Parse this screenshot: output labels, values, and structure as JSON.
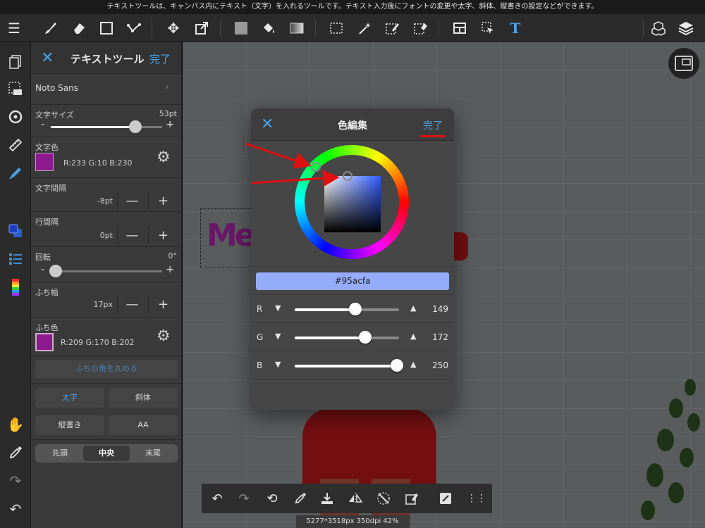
{
  "banner": "テキストツールは、キャンバス内にテキスト（文字）を入れるツールです。テキスト入力後にフォントの変更や太字、斜体、縦書きの設定などができます。",
  "panel": {
    "title": "テキストツール",
    "done": "完了",
    "font": "Noto Sans",
    "font_size_label": "文字サイズ",
    "font_size_value": "53pt",
    "font_size_level": 0.76,
    "text_color_label": "文字色",
    "text_color_rgb": "R:233 G:10 B:230",
    "text_color_hex": "#8e1a90",
    "letter_spacing_label": "文字間隔",
    "letter_spacing_value": "-8pt",
    "line_spacing_label": "行間隔",
    "line_spacing_value": "0pt",
    "rotation_label": "回転",
    "rotation_value": "0°",
    "rotation_level": 0.0,
    "border_width_label": "ふち幅",
    "border_width_value": "17px",
    "border_color_label": "ふち色",
    "border_color_rgb": "R:209 G:170 B:202",
    "border_color_hex": "#8e1a90",
    "round_corners": "ふちの角を丸める",
    "bold": "太字",
    "italic": "斜体",
    "vertical": "縦書き",
    "aa": "AA",
    "align": [
      "先頭",
      "中央",
      "末尾"
    ],
    "minus": "-",
    "plus": "+",
    "minus_btn": "—",
    "plus_btn": "+"
  },
  "canvas": {
    "text_preview": "Me"
  },
  "dialog": {
    "title": "色編集",
    "done": "完了",
    "hex": "#95acfa",
    "sliders": [
      {
        "name": "R",
        "value": "149",
        "level": 0.584
      },
      {
        "name": "G",
        "value": "172",
        "level": 0.675
      },
      {
        "name": "B",
        "value": "250",
        "level": 0.98
      }
    ],
    "down": "▼",
    "up": "▲"
  },
  "status": "5277*3518px 350dpi 42%",
  "colors": {
    "accent": "#4aa3e8",
    "annotation": "#e01010",
    "hex_bg": "#95acfa"
  }
}
